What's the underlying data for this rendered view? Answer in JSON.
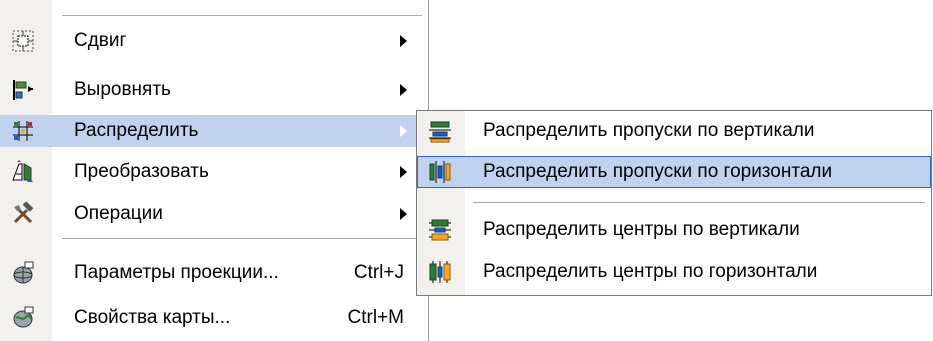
{
  "main_menu": {
    "items": [
      {
        "label": "Сдвиг",
        "shortcut": "",
        "submenu": true,
        "icon": "move-icon"
      },
      {
        "label": "Выровнять",
        "shortcut": "",
        "submenu": true,
        "icon": "align-icon"
      },
      {
        "label": "Распределить",
        "shortcut": "",
        "submenu": true,
        "icon": "distribute-icon"
      },
      {
        "label": "Преобразовать",
        "shortcut": "",
        "submenu": true,
        "icon": "transform-icon"
      },
      {
        "label": "Операции",
        "shortcut": "",
        "submenu": true,
        "icon": "tools-icon"
      },
      {
        "label": "Параметры проекции...",
        "shortcut": "Ctrl+J",
        "submenu": false,
        "icon": "projection-icon"
      },
      {
        "label": "Свойства карты...",
        "shortcut": "Ctrl+M",
        "submenu": false,
        "icon": "map-properties-icon"
      }
    ],
    "active_item": "Распределить"
  },
  "submenu": {
    "items": [
      {
        "label": "Распределить пропуски по вертикали",
        "icon": "distribute-gaps-vertical-icon"
      },
      {
        "label": "Распределить пропуски по горизонтали",
        "icon": "distribute-gaps-horizontal-icon"
      },
      {
        "label": "Распределить центры по вертикали",
        "icon": "distribute-centers-vertical-icon"
      },
      {
        "label": "Распределить центры по горизонтали",
        "icon": "distribute-centers-horizontal-icon"
      }
    ],
    "active_item": "Распределить пропуски по горизонтали"
  },
  "colors": {
    "highlight": "#c1d2ee",
    "highlight_border": "#316ac5",
    "gutter": "#f2f1ed"
  }
}
